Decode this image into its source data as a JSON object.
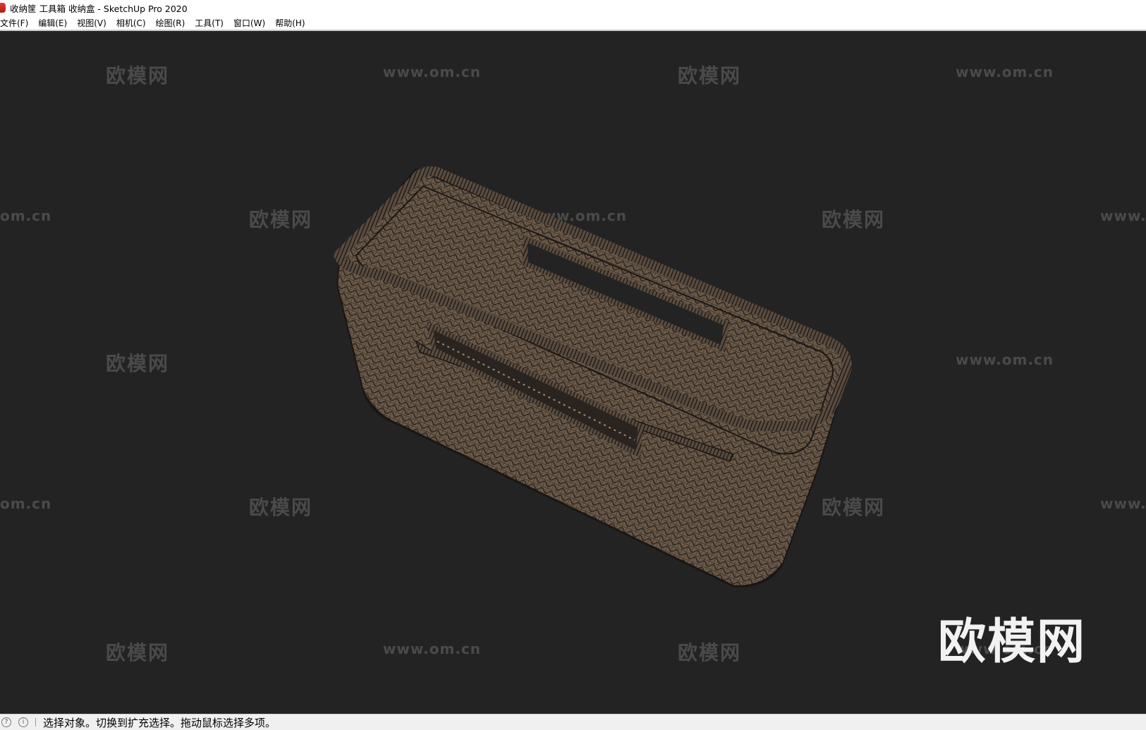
{
  "window": {
    "title": "收纳筐 工具箱 收纳盒 - SketchUp Pro 2020"
  },
  "menu": [
    {
      "label": "文件(F)"
    },
    {
      "label": "编辑(E)"
    },
    {
      "label": "视图(V)"
    },
    {
      "label": "相机(C)"
    },
    {
      "label": "绘图(R)"
    },
    {
      "label": "工具(T)"
    },
    {
      "label": "窗口(W)"
    },
    {
      "label": "帮助(H)"
    }
  ],
  "watermarks": {
    "brand": "欧模网",
    "url": "www.om.cn",
    "url_partial": "om.cn",
    "url_partial2": "www."
  },
  "status": {
    "message": "选择对象。切换到扩充选择。拖动鼠标选择多项。",
    "icon1": "help-icon",
    "icon2": "info-icon"
  },
  "colors": {
    "viewport_bg": "#232323",
    "model_fill": "#6b5a48",
    "model_lines": "#2a2420"
  }
}
